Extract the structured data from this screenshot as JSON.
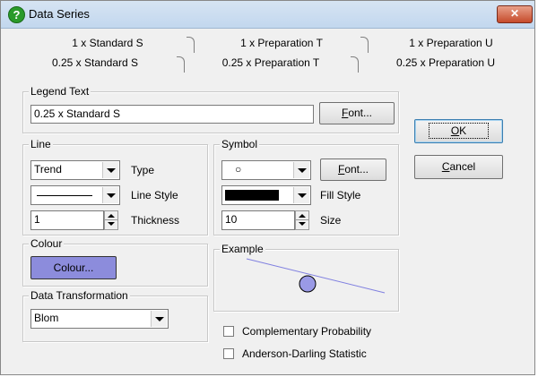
{
  "window": {
    "title": "Data Series",
    "close_label": "✕",
    "icon_label": "?"
  },
  "tabs": {
    "back_row": [
      "1 x Standard S",
      "1 x Preparation T",
      "1 x Preparation U"
    ],
    "front_row": [
      "0.25 x Standard S",
      "0.25 x Preparation T",
      "0.25 x Preparation U"
    ],
    "selected": "0.25 x Standard S"
  },
  "legend": {
    "title": "Legend Text",
    "value": "0.25 x Standard S",
    "font_button_label": "Font...",
    "font_button_mnemonic": "F",
    "font_button_rest": "ont..."
  },
  "line": {
    "title": "Line",
    "type_value": "Trend",
    "type_label": "Type",
    "style_label": "Line Style",
    "thickness_value": "1",
    "thickness_label": "Thickness"
  },
  "symbol": {
    "title": "Symbol",
    "symbol_value": "○",
    "font_button_mnemonic": "F",
    "font_button_rest": "ont...",
    "fill_label": "Fill Style",
    "fill_color": "#000000",
    "size_value": "10",
    "size_label": "Size"
  },
  "colour": {
    "title": "Colour",
    "button_label": "Colour...",
    "swatch_color": "#8c8cdc"
  },
  "example": {
    "title": "Example",
    "line_color": "#8080e0",
    "marker_fill": "#9a9ae6"
  },
  "transformation": {
    "title": "Data Transformation",
    "value": "Blom"
  },
  "options": {
    "complementary_label": "Complementary Probability",
    "complementary_checked": false,
    "anderson_label": "Anderson-Darling Statistic",
    "anderson_checked": false
  },
  "buttons": {
    "ok_mnemonic": "O",
    "ok_rest": "K",
    "cancel_mnemonic": "C",
    "cancel_rest": "ancel"
  }
}
